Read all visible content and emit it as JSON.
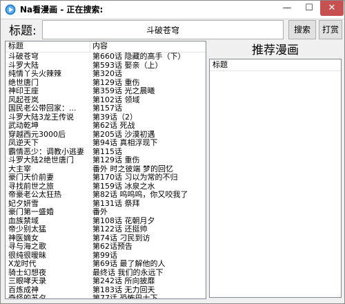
{
  "window": {
    "title": "Na看漫画 - 正在搜索:",
    "min_glyph": "—",
    "max_glyph": "☐",
    "close_glyph": "✕"
  },
  "search": {
    "label": "标题:",
    "value": "斗破苍穹",
    "search_button": "搜索",
    "print_button": "打赏"
  },
  "list": {
    "columns": [
      "标题",
      "内容"
    ],
    "rows": [
      [
        "斗破苍穹",
        "第660话 隐藏的高手（下）"
      ],
      [
        "斗罗大陆",
        "第593话 娶亲（上）"
      ],
      [
        "纯情丫头火辣辣",
        "第320话"
      ],
      [
        "绝世唐门",
        "第129话 重伤"
      ],
      [
        "神印王座",
        "第359话 光之晨曦"
      ],
      [
        "风起苍岚",
        "第102话 领域"
      ],
      [
        "国民老公带回家：...",
        "第157话"
      ],
      [
        "斗罗大陆3龙王传说",
        "第39话（2）"
      ],
      [
        "武动乾坤",
        "第62话 死战"
      ],
      [
        "穿越西元3000后",
        "第205话 沙漠初遇"
      ],
      [
        "凤逆天下",
        "第94话 真相浮现下"
      ],
      [
        "霸情恶少：调教小逃妻",
        "第115话"
      ],
      [
        "斗罗大陆2绝世唐门",
        "第129话 重伤"
      ],
      [
        "大主宰",
        "番外 时之彼端 梦的回忆"
      ],
      [
        "豪门天价前妻",
        "第170话 习以为常的不归"
      ],
      [
        "寻找前世之旅",
        "第159话 冰泉之水"
      ],
      [
        "帝豪老公太狂热",
        "第82话 呜呜呜，你又咬我了"
      ],
      [
        "妃夕妍雪",
        "第131话 祭拜"
      ],
      [
        "豪门第一盛婚",
        "番外"
      ],
      [
        "血族禁域",
        "第108话 花朝月夕"
      ],
      [
        "帝少别太猛",
        "第122话 还挺帅"
      ],
      [
        "神医嫡女",
        "第74话 刁民到访"
      ],
      [
        "寻与海之歌",
        "第62话预告"
      ],
      [
        "很纯很暧昧",
        "第99话"
      ],
      [
        "X龙时代",
        "第69话 最了解他的人"
      ],
      [
        "骑士幻想夜",
        "最终话 我们的永远下"
      ],
      [
        "三眼哮天录",
        "第242话 所向披靡"
      ],
      [
        "百炼成神",
        "第183话 无力回天"
      ],
      [
        "奇怪的苏夕",
        "第77话 恐怖巴士下"
      ],
      [
        "极品辣妈好V5",
        "第109话"
      ]
    ]
  },
  "recommend": {
    "title": "推荐漫画",
    "column": "标题"
  }
}
